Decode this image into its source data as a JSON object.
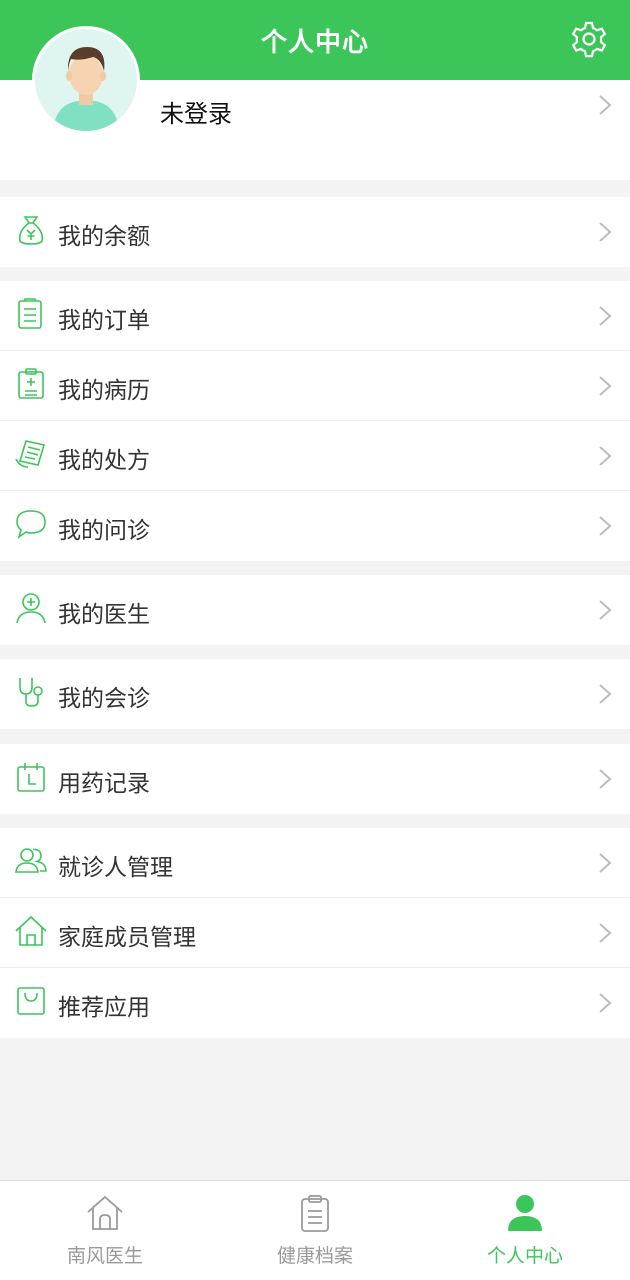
{
  "header": {
    "title": "个人中心",
    "settings_icon": "gear-icon"
  },
  "profile": {
    "login_text": "未登录",
    "avatar_icon": "user-avatar"
  },
  "colors": {
    "accent": "#3cc65a",
    "background": "#f3f3f3",
    "text": "#333333",
    "tab_inactive": "#9a9a9a"
  },
  "menu": {
    "balance": {
      "label": "我的余额",
      "icon": "money-bag-icon"
    },
    "orders": {
      "label": "我的订单",
      "icon": "clipboard-list-icon"
    },
    "records": {
      "label": "我的病历",
      "icon": "medical-record-icon"
    },
    "prescriptions": {
      "label": "我的处方",
      "icon": "prescription-icon"
    },
    "consults": {
      "label": "我的问诊",
      "icon": "chat-bubble-icon"
    },
    "doctors": {
      "label": "我的医生",
      "icon": "doctor-icon"
    },
    "joint_consults": {
      "label": "我的会诊",
      "icon": "stethoscope-icon"
    },
    "medication": {
      "label": "用药记录",
      "icon": "medication-record-icon"
    },
    "patients": {
      "label": "就诊人管理",
      "icon": "people-icon"
    },
    "family": {
      "label": "家庭成员管理",
      "icon": "home-icon"
    },
    "apps": {
      "label": "推荐应用",
      "icon": "shopping-bag-icon"
    }
  },
  "tabs": [
    {
      "label": "南风医生",
      "icon": "home-outline-icon",
      "active": false
    },
    {
      "label": "健康档案",
      "icon": "clipboard-icon",
      "active": false
    },
    {
      "label": "个人中心",
      "icon": "person-icon",
      "active": true
    }
  ]
}
